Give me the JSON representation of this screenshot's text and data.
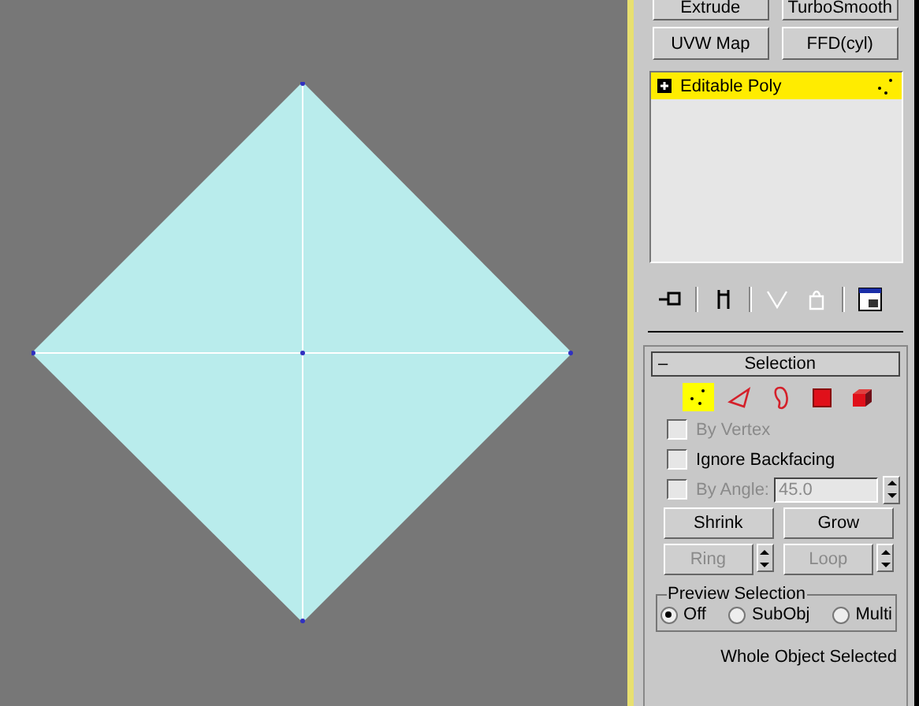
{
  "modifier_buttons": [
    {
      "label": "Extrude"
    },
    {
      "label": "TurboSmooth"
    },
    {
      "label": "UVW Map"
    },
    {
      "label": "FFD(cyl)"
    }
  ],
  "modifier_stack": [
    {
      "label": "Editable Poly",
      "selected": true,
      "expanded": false
    }
  ],
  "stack_toolbar": [
    {
      "kind": "pin",
      "disabled": false
    },
    {
      "kind": "result",
      "disabled": false
    },
    {
      "kind": "unique",
      "disabled": true
    },
    {
      "kind": "remove",
      "disabled": true
    },
    {
      "kind": "configure",
      "disabled": false
    }
  ],
  "selection_rollout": {
    "collapse": "–",
    "title": "Selection",
    "subobject_levels": [
      {
        "kind": "vertex",
        "selected": true
      },
      {
        "kind": "edge",
        "selected": false
      },
      {
        "kind": "border",
        "selected": false
      },
      {
        "kind": "polygon",
        "selected": false
      },
      {
        "kind": "element",
        "selected": false
      }
    ],
    "checkboxes": [
      {
        "label": "By Vertex",
        "checked": false,
        "disabled": true
      },
      {
        "label": "Ignore Backfacing",
        "checked": false,
        "disabled": false
      }
    ],
    "by_angle": {
      "label": "By Angle:",
      "checked": false,
      "disabled": true,
      "value": "45.0"
    },
    "buttons": [
      {
        "label": "Shrink",
        "disabled": false,
        "spinner": false
      },
      {
        "label": "Grow",
        "disabled": false,
        "spinner": false
      },
      {
        "label": "Ring",
        "disabled": true,
        "spinner": true
      },
      {
        "label": "Loop",
        "disabled": true,
        "spinner": true
      }
    ],
    "preview_selection": {
      "title": "Preview Selection",
      "options": [
        {
          "label": "Off",
          "selected": true
        },
        {
          "label": "SubObj",
          "selected": false
        },
        {
          "label": "Multi",
          "selected": false
        }
      ]
    },
    "status": "Whole Object Selected"
  }
}
